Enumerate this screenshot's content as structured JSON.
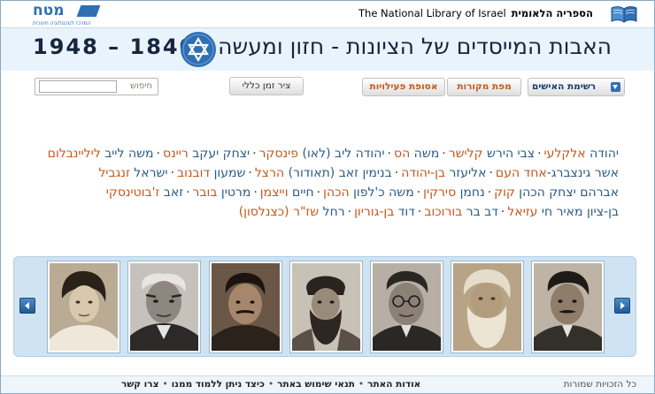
{
  "topbar": {
    "matach_logo": {
      "word": "מטח",
      "tagline": "המרכז לטכנולוגיה חינוכית"
    },
    "nli": {
      "english": "The National Library of Israel",
      "hebrew": "הספריה הלאומית"
    }
  },
  "header": {
    "title": "האבות המייסדים של הציונות - חזון ומעשה",
    "years": "1948 – 1840",
    "colors": {
      "background": "#e9f3fb",
      "text": "#16263e",
      "star": "#2f6fb3"
    }
  },
  "toolbar": {
    "search": {
      "label": "חיפוש",
      "value": ""
    },
    "timeline_button": "ציר זמן כללי",
    "buttons": [
      {
        "label": "רשימת האישים",
        "style": "blue"
      },
      {
        "label": "מפת מקורות",
        "style": "orange"
      },
      {
        "label": "אסופת פעילויות",
        "style": "orange"
      }
    ]
  },
  "names": {
    "lines": [
      [
        {
          "first": "יהודה",
          "last": "אלקלעי"
        },
        {
          "first": "צבי הירש",
          "last": "קלישר"
        },
        {
          "first": "משה",
          "last": "הס"
        },
        {
          "first": "יהודה ליב (לאו)",
          "last": "פינסקר"
        },
        {
          "first": "יצחק יעקב",
          "last": "ריינס"
        },
        {
          "first": "משה לייב",
          "last": "ליליינבלום"
        }
      ],
      [
        {
          "first": "אשר גינצברג-",
          "last": "אחד העם"
        },
        {
          "first": "אליעזר",
          "last": "בן-יהודה"
        },
        {
          "first": "בנימין זאב (תאודור)",
          "last": "הרצל"
        },
        {
          "first": "שמעון",
          "last": "דובנוב"
        },
        {
          "first": "ישראל",
          "last": "זנגביל"
        }
      ],
      [
        {
          "first": "אברהם יצחק הכהן",
          "last": "קוק"
        },
        {
          "first": "נחמן",
          "last": "סירקין"
        },
        {
          "first": "משה כ'לפון",
          "last": "הכהן"
        },
        {
          "first": "חיים",
          "last": "וייצמן"
        },
        {
          "first": "מרטין",
          "last": "בובר"
        },
        {
          "first": "זאב",
          "last": "ז'בוטינסקי"
        }
      ],
      [
        {
          "first": "בן-ציון מאיר חי",
          "last": "עזיאל"
        },
        {
          "first": "דב בר",
          "last": "בורוכוב"
        },
        {
          "first": "דוד",
          "last": "בן-גוריון"
        },
        {
          "first": "רחל",
          "last": "שז\"ר (כצנלסון)"
        }
      ]
    ],
    "colors": {
      "first_name": "#2a5b86",
      "last_name": "#c2591b"
    }
  },
  "carousel": {
    "photos": [
      {
        "subject": "portrait-woman"
      },
      {
        "subject": "portrait-bald-man-suit"
      },
      {
        "subject": "portrait-young-man"
      },
      {
        "subject": "portrait-rabbi-turban"
      },
      {
        "subject": "portrait-man-glasses"
      },
      {
        "subject": "portrait-bearded-elder"
      },
      {
        "subject": "portrait-man-mustache"
      }
    ]
  },
  "footer": {
    "copyright": "כל הזכויות שמורות",
    "links": [
      "אודות האתר",
      "תנאי שימוש באתר",
      "כיצד ניתן ללמוד ממנו",
      "צרו קשר"
    ]
  }
}
